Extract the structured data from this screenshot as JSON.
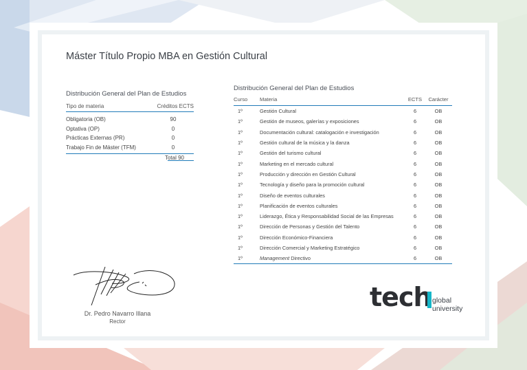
{
  "title": "Máster Título Propio MBA en Gestión Cultural",
  "summary": {
    "title": "Distribución General del Plan de Estudios",
    "header": {
      "type": "Tipo de materia",
      "credits": "Créditos ECTS"
    },
    "rows": [
      {
        "type": "Obligatoria (OB)",
        "credits": "90"
      },
      {
        "type": "Optativa (OP)",
        "credits": "0"
      },
      {
        "type": "Prácticas Externas (PR)",
        "credits": "0"
      },
      {
        "type": "Trabajo Fin de Máster (TFM)",
        "credits": "0"
      }
    ],
    "total": "Total 90"
  },
  "plan": {
    "title": "Distribución General del Plan de Estudios",
    "header": {
      "curso": "Curso",
      "materia": "Materia",
      "ects": "ECTS",
      "caracter": "Carácter"
    },
    "rows": [
      {
        "curso": "1º",
        "materia": "Gestión Cultural",
        "ects": "6",
        "caracter": "OB"
      },
      {
        "curso": "1º",
        "materia": "Gestión de museos, galerías y exposiciones",
        "ects": "6",
        "caracter": "OB"
      },
      {
        "curso": "1º",
        "materia": "Documentación cultural: catalogación e investigación",
        "ects": "6",
        "caracter": "OB"
      },
      {
        "curso": "1º",
        "materia": "Gestión cultural de la música y la danza",
        "ects": "6",
        "caracter": "OB"
      },
      {
        "curso": "1º",
        "materia": "Gestión del turismo cultural",
        "ects": "6",
        "caracter": "OB"
      },
      {
        "curso": "1º",
        "materia": "Marketing en el mercado cultural",
        "ects": "6",
        "caracter": "OB"
      },
      {
        "curso": "1º",
        "materia": "Producción y dirección en Gestión Cultural",
        "ects": "6",
        "caracter": "OB"
      },
      {
        "curso": "1º",
        "materia": "Tecnología y diseño para la promoción cultural",
        "ects": "6",
        "caracter": "OB"
      },
      {
        "curso": "1º",
        "materia": "Diseño de eventos culturales",
        "ects": "6",
        "caracter": "OB"
      },
      {
        "curso": "1º",
        "materia": "Planificación de eventos culturales",
        "ects": "6",
        "caracter": "OB"
      },
      {
        "curso": "1º",
        "materia": "Liderazgo, Ética y Responsabilidad Social de las Empresas",
        "ects": "6",
        "caracter": "OB"
      },
      {
        "curso": "1º",
        "materia": "Dirección de Personas y Gestión del Talento",
        "ects": "6",
        "caracter": "OB"
      },
      {
        "curso": "1º",
        "materia": "Dirección Económico-Financiera",
        "ects": "6",
        "caracter": "OB"
      },
      {
        "curso": "1º",
        "materia": "Dirección Comercial y Marketing Estratégico",
        "ects": "6",
        "caracter": "OB"
      },
      {
        "curso": "1º",
        "materia_italic": "Management",
        "materia": " Directivo",
        "ects": "6",
        "caracter": "OB"
      }
    ]
  },
  "signature": {
    "name": "Dr. Pedro Navarro Illana",
    "role": "Rector"
  },
  "logo": {
    "tec": "tech",
    "line1": "global",
    "line2": "university",
    "accent": "#16b6c8"
  },
  "colors": {
    "rule": "#1f7ab8"
  }
}
